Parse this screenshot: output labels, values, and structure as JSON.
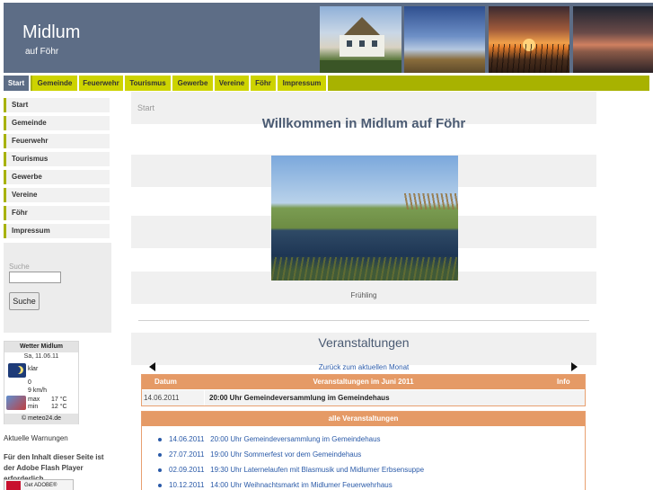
{
  "site": {
    "title": "Midlum",
    "subtitle": "auf Föhr"
  },
  "topnav": {
    "items": [
      {
        "label": "Start",
        "active": true
      },
      {
        "label": "Gemeinde",
        "active": false
      },
      {
        "label": "Feuerwehr",
        "active": false
      },
      {
        "label": "Tourismus",
        "active": false
      },
      {
        "label": "Gewerbe",
        "active": false
      },
      {
        "label": "Vereine",
        "active": false
      },
      {
        "label": "Föhr",
        "active": false
      },
      {
        "label": "Impressum",
        "active": false
      }
    ]
  },
  "sidebar": {
    "items": [
      {
        "label": "Start"
      },
      {
        "label": "Gemeinde"
      },
      {
        "label": "Feuerwehr"
      },
      {
        "label": "Tourismus"
      },
      {
        "label": "Gewerbe"
      },
      {
        "label": "Vereine"
      },
      {
        "label": "Föhr"
      },
      {
        "label": "Impressum"
      }
    ],
    "search": {
      "label": "Suche",
      "value": "",
      "button_label": "Suche"
    }
  },
  "weather": {
    "title": "Wetter Midlum",
    "date": "Sa, 11.06.11",
    "condition": "klar",
    "wind_value": "0",
    "wind_unit": "9 km/h",
    "max_label": "max",
    "min_label": "min",
    "max_value": "17 °C",
    "min_value": "12 °C",
    "footer": "© meteo24.de"
  },
  "warnings_link": "Aktuelle Warnungen",
  "flash_notice": "Für den Inhalt dieser Seite ist der Adobe Flash Player erforderlich.",
  "get_adobe_label": "Get ADOBE® FLASH® PLAYER",
  "main": {
    "breadcrumb": "Start",
    "title": "Willkommen in Midlum auf Föhr",
    "photo_caption": "Frühling",
    "events_heading": "Veranstaltungen",
    "back_link": "Zurück zum aktuellen Monat",
    "calendar": {
      "col_date": "Datum",
      "title": "Veranstaltungen im Juni 2011",
      "col_info": "Info",
      "row": {
        "date": "14.06.2011",
        "event": "20:00 Uhr Gemeindeversammlung im Gemeindehaus"
      }
    },
    "all_events": {
      "header": "alle Veranstaltungen",
      "items": [
        {
          "date": "14.06.2011",
          "text": "20:00 Uhr Gemeindeversammlung im Gemeindehaus"
        },
        {
          "date": "27.07.2011",
          "text": "19:00 Uhr Sommerfest vor dem Gemeindehaus"
        },
        {
          "date": "02.09.2011",
          "text": "19:30 Uhr Laternelaufen mit Blasmusik und Midlumer Erbsensuppe"
        },
        {
          "date": "10.12.2011",
          "text": "14:00 Uhr Weihnachtsmarkt im Midlumer Feuerwehrhaus"
        }
      ]
    }
  },
  "colors": {
    "header_bg": "#5d6d86",
    "nav_accent": "#cdd300",
    "nav_bar": "#a8b200",
    "table_header": "#e59a66",
    "link": "#2a5aa8"
  }
}
